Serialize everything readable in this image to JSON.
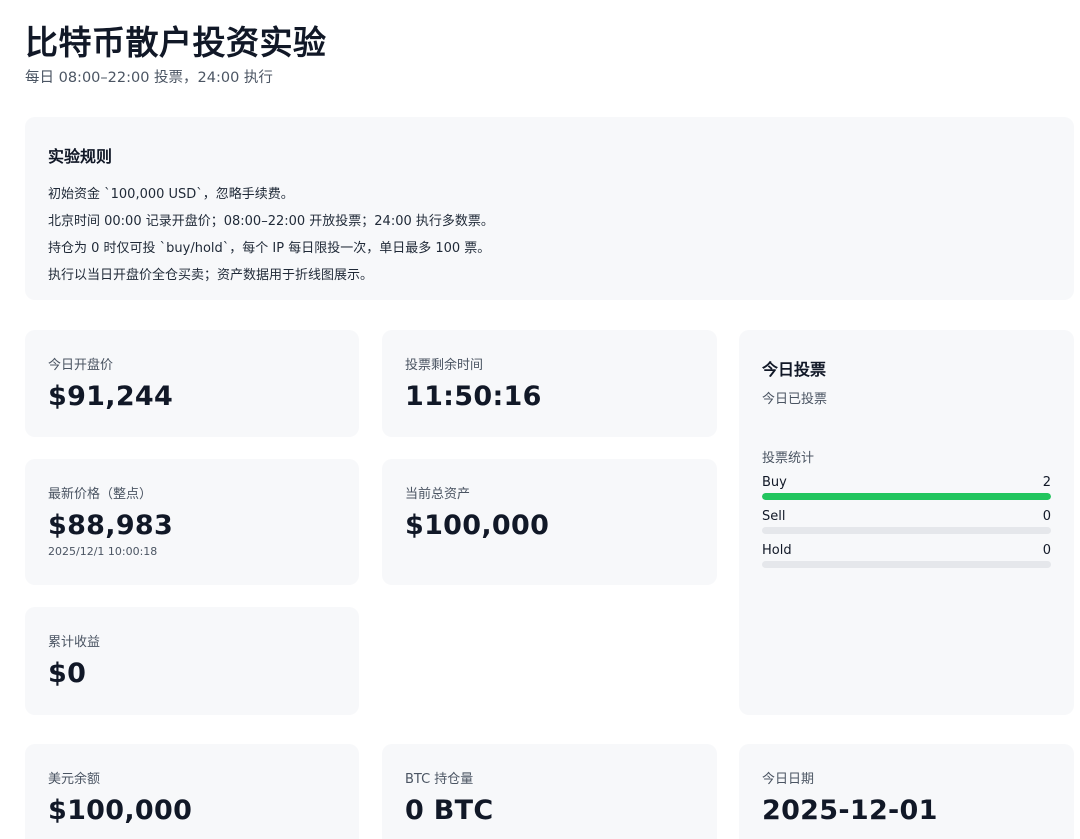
{
  "header": {
    "title": "比特币散户投资实验",
    "subtitle": "每日 08:00–22:00 投票，24:00 执行"
  },
  "rules": {
    "title": "实验规则",
    "items": [
      "初始资金 `100,000 USD`，忽略手续费。",
      "北京时间 00:00 记录开盘价；08:00–22:00 开放投票；24:00 执行多数票。",
      "持仓为 0 时仅可投 `buy/hold`，每个 IP 每日限投一次，单日最多 100 票。",
      "执行以当日开盘价全仓买卖；资产数据用于折线图展示。"
    ]
  },
  "stats": {
    "open_price": {
      "label": "今日开盘价",
      "value": "$91,244"
    },
    "vote_remaining": {
      "label": "投票剩余时间",
      "value": "11:50:16"
    },
    "latest_price": {
      "label": "最新价格（整点）",
      "value": "$88,983",
      "timestamp": "2025/12/1 10:00:18"
    },
    "total_assets": {
      "label": "当前总资产",
      "value": "$100,000"
    },
    "cumulative_return": {
      "label": "累计收益",
      "value": "$0"
    },
    "usd_balance": {
      "label": "美元余额",
      "value": "$100,000"
    },
    "btc_holding": {
      "label": "BTC 持仓量",
      "value": "0 BTC"
    },
    "today_date": {
      "label": "今日日期",
      "value": "2025-12-01"
    }
  },
  "vote": {
    "title": "今日投票",
    "status": "今日已投票",
    "stats_title": "投票统计",
    "options": [
      {
        "label": "Buy",
        "count": "2",
        "fraction": 1.0
      },
      {
        "label": "Sell",
        "count": "0",
        "fraction": 0.0
      },
      {
        "label": "Hold",
        "count": "0",
        "fraction": 0.0
      }
    ],
    "bar_color": "#22c55e"
  }
}
